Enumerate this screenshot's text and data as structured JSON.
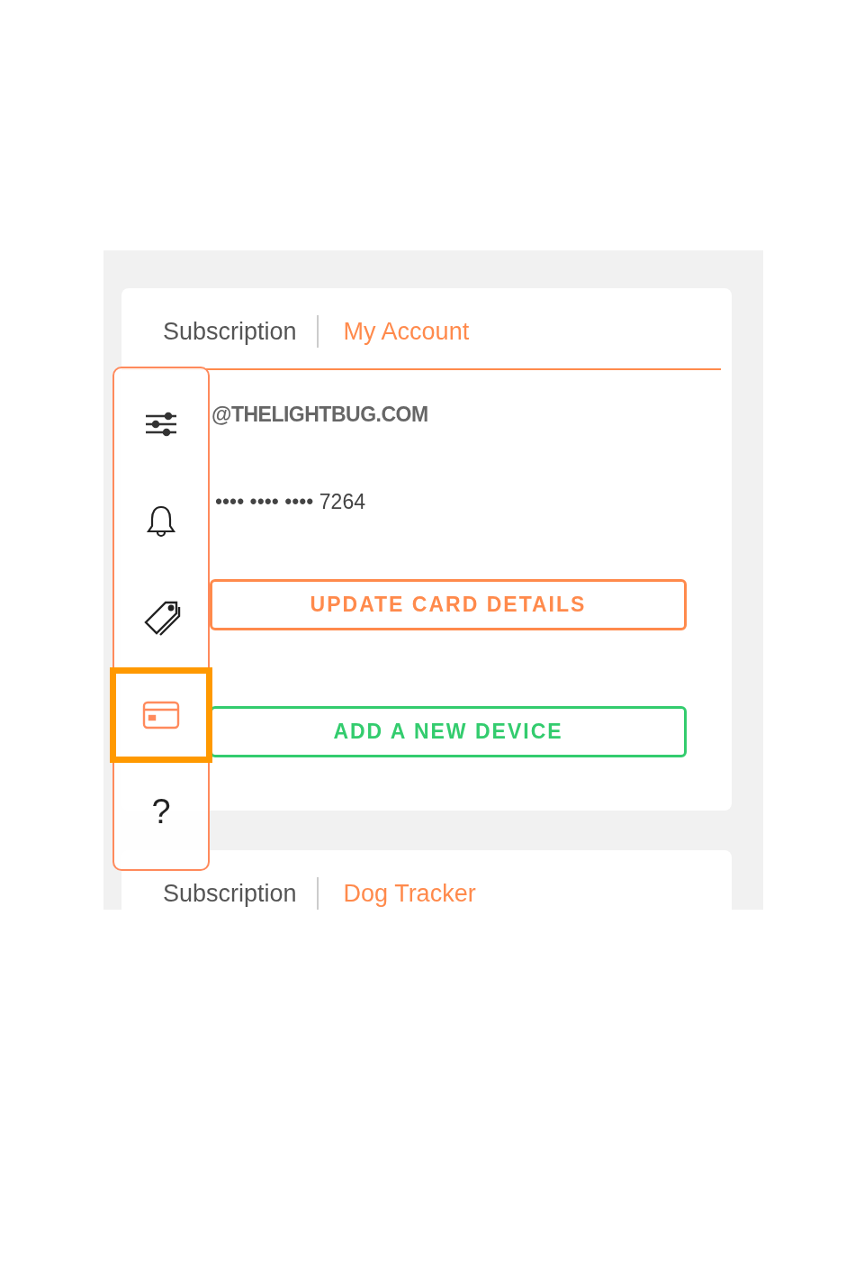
{
  "account_card": {
    "tabs": [
      {
        "label": "Subscription",
        "selected": false
      },
      {
        "label": "My Account",
        "selected": true
      }
    ],
    "email": "@THELIGHTBUG.COM",
    "card_number": "•••• •••• •••• 7264",
    "buttons": [
      {
        "label": "UPDATE CARD DETAILS",
        "kind": "primary"
      },
      {
        "label": "ADD A NEW DEVICE",
        "kind": "success"
      }
    ]
  },
  "device_card": {
    "tabs": [
      {
        "label": "Subscription",
        "selected": false
      },
      {
        "label": "Dog Tracker",
        "selected": true
      }
    ]
  },
  "sidebar": {
    "items": [
      {
        "kind": "settings",
        "selected": false
      },
      {
        "kind": "bell",
        "selected": false
      },
      {
        "kind": "tag",
        "selected": false
      },
      {
        "kind": "card",
        "selected": true
      },
      {
        "kind": "help",
        "label": "?",
        "selected": false
      }
    ]
  }
}
